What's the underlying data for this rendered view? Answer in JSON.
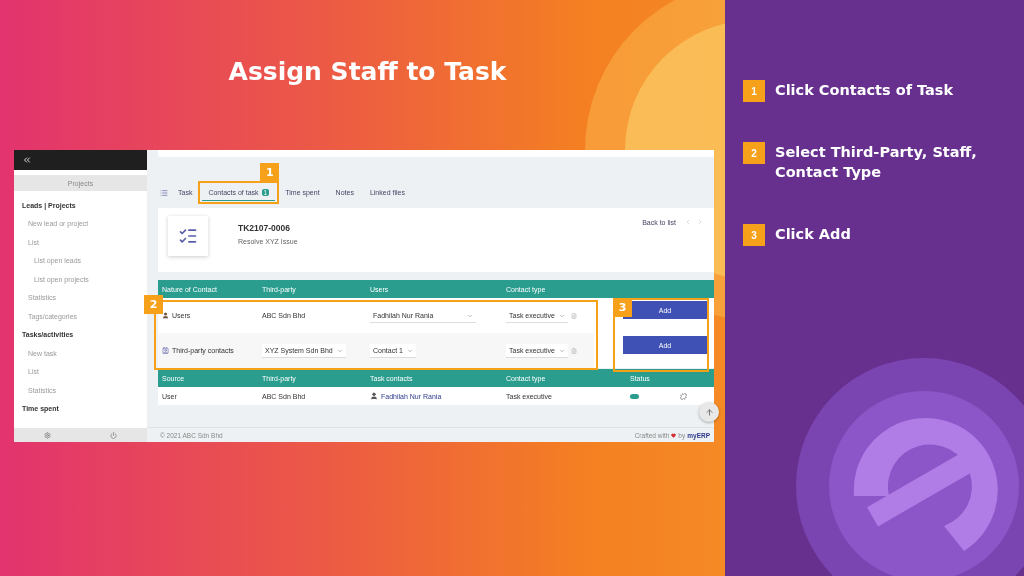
{
  "title": "Assign Staff to Task",
  "sidebar": {
    "header": "Projects",
    "sections": [
      {
        "label": "Leads | Projects",
        "children": [
          {
            "label": "New lead or project"
          },
          {
            "label": "List",
            "children": [
              {
                "label": "List open leads"
              },
              {
                "label": "List open projects"
              }
            ]
          },
          {
            "label": "Statistics"
          },
          {
            "label": "Tags/categories"
          }
        ]
      },
      {
        "label": "Tasks/activities",
        "children": [
          {
            "label": "New task"
          },
          {
            "label": "List"
          },
          {
            "label": "Statistics"
          }
        ]
      },
      {
        "label": "Time spent"
      }
    ]
  },
  "tabs": [
    {
      "label": "Task",
      "selected": false
    },
    {
      "label": "Contacts of task",
      "selected": true,
      "badge": "1",
      "callout": "1"
    },
    {
      "label": "Time spent",
      "selected": false
    },
    {
      "label": "Notes",
      "selected": false
    },
    {
      "label": "Linked files",
      "selected": false
    }
  ],
  "task": {
    "ref": "TK2107-0006",
    "name": "Resolve XYZ Issue",
    "back": "Back to list"
  },
  "add_table": {
    "columns": [
      "Nature of Contact",
      "Third-party",
      "Users",
      "Contact type"
    ],
    "callout": "2",
    "button_callout": "3",
    "rows": [
      {
        "kind": "user",
        "nature": "Users",
        "third_party": {
          "value": "ABC Sdn Bhd",
          "dropdown": false
        },
        "users": {
          "value": "Fadhilah Nur Rania",
          "dropdown": true
        },
        "contact_type": {
          "value": "Task executive",
          "dropdown": true
        },
        "button": "Add"
      },
      {
        "kind": "third-party",
        "nature": "Third-party contacts",
        "third_party": {
          "value": "XYZ System Sdn Bhd",
          "dropdown": true
        },
        "users": {
          "value": "Contact 1",
          "dropdown": true
        },
        "contact_type": {
          "value": "Task executive",
          "dropdown": true
        },
        "button": "Add"
      }
    ]
  },
  "contacts_table": {
    "columns": [
      "Source",
      "Third-party",
      "Task contacts",
      "Contact type",
      "Status"
    ],
    "rows": [
      {
        "source": "User",
        "third_party": "ABC Sdn Bhd",
        "contact": "Fadhilah Nur Rania",
        "contact_type": "Task executive"
      }
    ]
  },
  "footer": {
    "copyright": "© 2021 ABC Sdn Bhd",
    "credit": "Crafted with",
    "by": "by",
    "brand": "myERP"
  },
  "steps": [
    {
      "number": "1",
      "text": "Click Contacts of Task"
    },
    {
      "number": "2",
      "text": "Select Third-Party, Staff, Contact Type"
    },
    {
      "number": "3",
      "text": "Click Add"
    }
  ]
}
